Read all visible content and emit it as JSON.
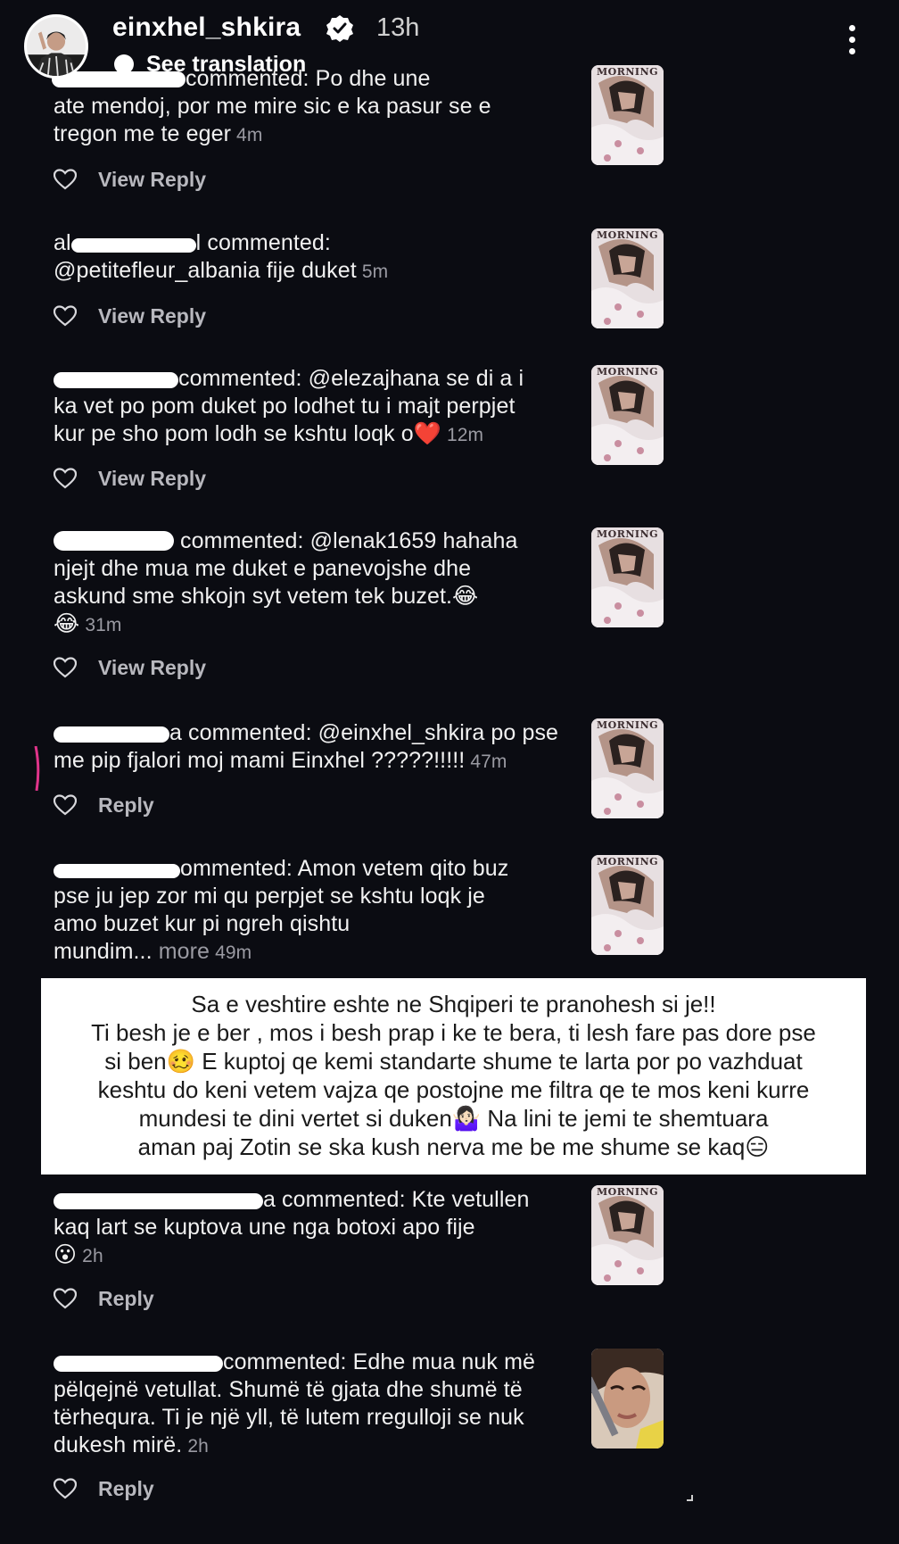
{
  "header": {
    "username": "einxhel_shkira",
    "time": "13h",
    "see_translation": "See translation"
  },
  "comments": [
    {
      "prefix": "commented: Po dhe une",
      "lines": [
        "ate mendoj, por me mire sic e ka pasur se e",
        "tregon me te eger"
      ],
      "time": "4m",
      "reply": "View Reply"
    },
    {
      "prefix": "al",
      "prefix2": "l commented:",
      "lines": [
        "@petitefleur_albania fije duket"
      ],
      "time": "5m",
      "reply": "View Reply"
    },
    {
      "prefix": "commented: @elezajhana se di a i",
      "lines": [
        "ka vet po pom duket po lodhet tu i majt perpjet",
        "kur pe sho pom lodh se kshtu loqk o❤️"
      ],
      "time": "12m",
      "reply": "View Reply"
    },
    {
      "prefix": "commented: @lenak1659 hahaha",
      "lines": [
        "njejt dhe mua me duket e panevojshe dhe",
        "askund sme shkojn syt vetem tek buzet.😂",
        "😂"
      ],
      "time": "31m",
      "reply": "View Reply"
    },
    {
      "prefix": "a commented: @einxhel_shkira po pse",
      "lines": [
        "me  pip  fjalori moj mami Einxhel ?????!!!!!"
      ],
      "time": "47m",
      "reply": "Reply"
    },
    {
      "prefix": "ommented: Amon vetem qito buz",
      "lines": [
        "pse ju jep zor mi qu perpjet se kshtu loqk je",
        "amo buzet kur pi ngreh qishtu",
        "mundim..."
      ],
      "more": "more",
      "time": "49m"
    },
    {
      "prefix": "a commented: Kte vetullen",
      "lines": [
        "kaq lart se kuptova une nga botoxi apo fije",
        "😮"
      ],
      "time": "2h",
      "reply": "Reply"
    },
    {
      "prefix": "commented: Edhe mua nuk më",
      "lines": [
        "pëlqejnë vetullat. Shumë të gjata dhe shumë të",
        "tërhequra. Ti je një yll, të lutem rregulloji se nuk",
        "dukesh mirë."
      ],
      "time": "2h",
      "reply": "Reply"
    }
  ],
  "thumbnail_title": "MORNING",
  "caption": {
    "lines": [
      "Sa e veshtire eshte ne Shqiperi te pranohesh si je!!",
      "Ti besh je e ber , mos i besh prap i ke te bera, ti lesh fare pas dore pse",
      "si ben🥴 E kuptoj qe kemi standarte shume te larta por po vazhduat",
      "keshtu do keni vetem vajza qe postojne me filtra qe te mos keni kurre",
      "mundesi te dini vertet si duken🤷🏻‍♀️ Na lini te jemi te shemtuara",
      "aman paj Zotin se ska kush nerva me be me shume se kaq😑"
    ]
  },
  "colors": {
    "background": "#0b0c12",
    "text": "#f1f1f1",
    "muted": "#9a9aa2",
    "caption_bg": "#ffffff"
  },
  "icons": {
    "like": "heart-outline-icon",
    "verified": "verified-badge-icon",
    "more": "vertical-dots-icon"
  }
}
